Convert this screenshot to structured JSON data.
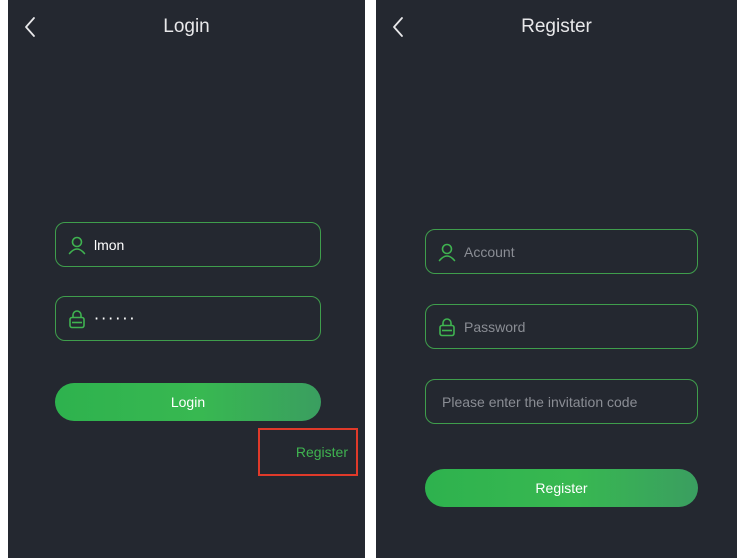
{
  "login": {
    "title": "Login",
    "username_value": "lmon",
    "password_masked": "······",
    "login_label": "Login",
    "register_link": "Register"
  },
  "register": {
    "title": "Register",
    "account_placeholder": "Account",
    "password_placeholder": "Password",
    "invitation_placeholder": "Please enter the invitation code",
    "register_label": "Register"
  },
  "colors": {
    "background": "#242830",
    "accent": "#3f9e4c",
    "button_gradient_start": "#2eb24e",
    "button_gradient_end": "#3a9e60",
    "highlight": "#e03a2a"
  }
}
